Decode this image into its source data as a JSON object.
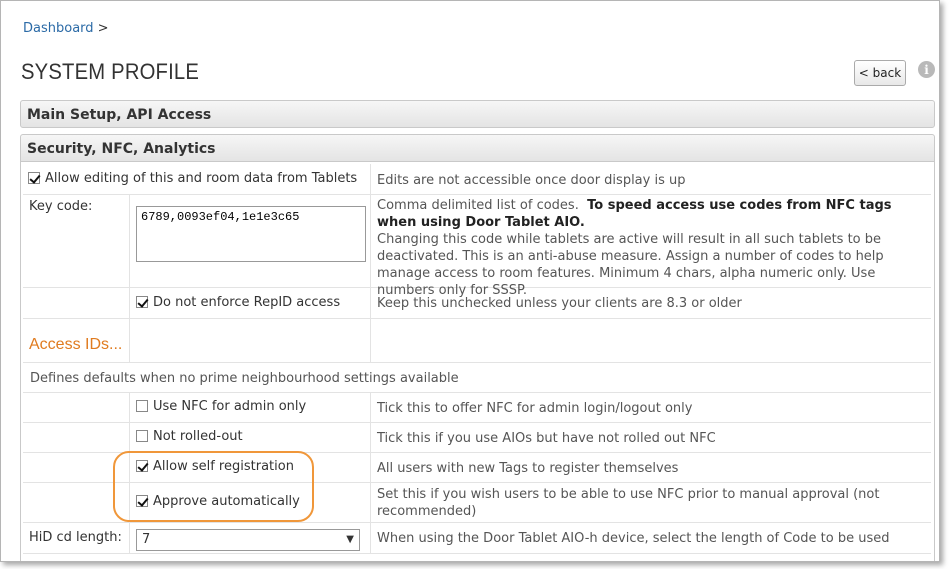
{
  "breadcrumb": {
    "link": "Dashboard",
    "separator": ">"
  },
  "page_title": "SYSTEM PROFILE",
  "back_button": "< back",
  "info_icon": "i",
  "sections": {
    "main_setup": "Main Setup, API Access",
    "security": "Security, NFC, Analytics"
  },
  "rows": {
    "allow_editing": {
      "label": "Allow editing of this and room data from Tablets",
      "checked": true,
      "desc": "Edits are not accessible once door display is up"
    },
    "key_code": {
      "label": "Key code:",
      "value": "6789,0093ef04,1e1e3c65",
      "desc_plain": "Comma delimited list of codes.",
      "desc_bold": "To speed access use codes from NFC tags when using Door Tablet AIO.",
      "desc_rest": "Changing this code while tablets are active will result in all such tablets to be deactivated. This is an anti-abuse measure. Assign a number of codes to help manage access to room features.  Minimum 4 chars, alpha numeric only. Use numbers only for SSSP."
    },
    "repid": {
      "label": "Do not enforce RepID access",
      "checked": true,
      "desc": "Keep this unchecked unless your clients are 8.3 or older"
    },
    "access_ids": {
      "heading": "Access IDs..."
    },
    "defaults": {
      "text": "Defines defaults when no prime neighbourhood settings available"
    },
    "nfc_admin": {
      "label": "Use NFC for admin only",
      "checked": false,
      "desc": "Tick this to offer NFC for admin login/logout only"
    },
    "not_rolled": {
      "label": "Not rolled-out",
      "checked": false,
      "desc": "Tick this if you use AIOs but have not rolled out NFC"
    },
    "self_reg": {
      "label": "Allow self registration",
      "checked": true,
      "desc": "All users with new Tags to register themselves"
    },
    "approve": {
      "label": "Approve automatically",
      "checked": true,
      "desc": "Set this if you wish users to be able to use NFC prior to manual approval (not recommended)"
    },
    "hid": {
      "label": "HiD cd length:",
      "value": "7",
      "desc": "When using the Door Tablet AIO-h device, select the length of Code to be used"
    }
  },
  "colors": {
    "accent_orange": "#e07b1f",
    "highlight_ring": "#f0973a",
    "link_blue": "#2b6aa6"
  }
}
